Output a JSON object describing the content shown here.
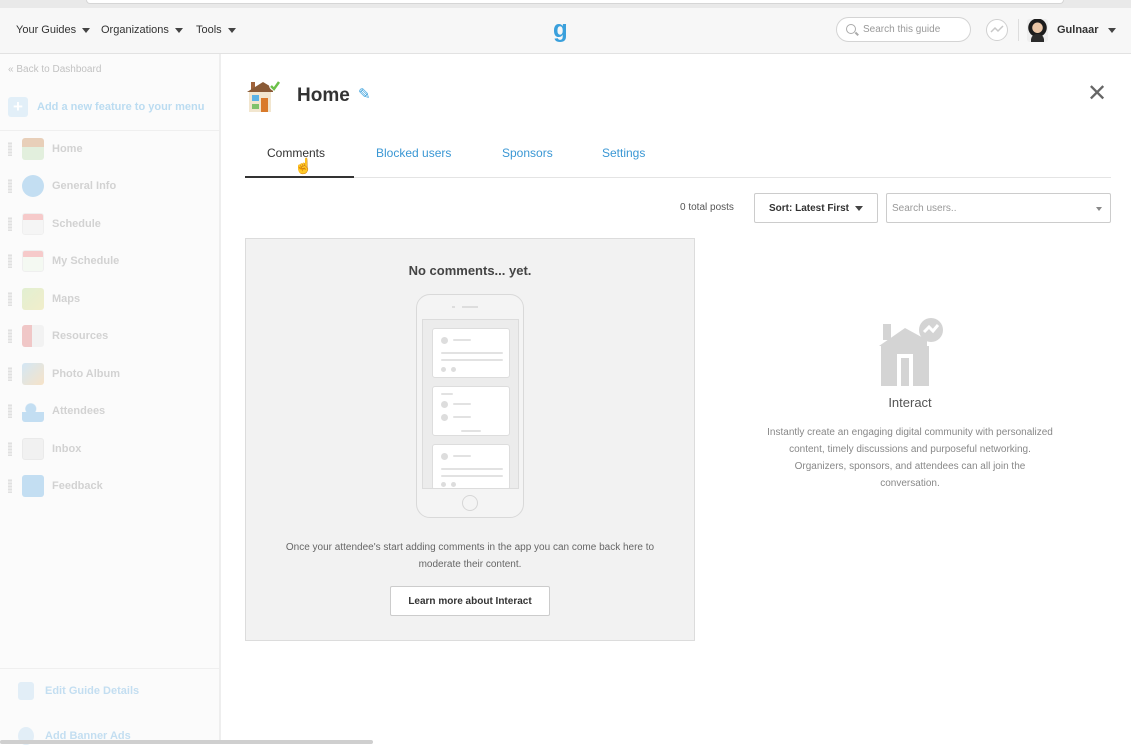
{
  "topbar": {
    "menus": [
      {
        "label": "Your Guides"
      },
      {
        "label": "Organizations"
      },
      {
        "label": "Tools"
      }
    ],
    "logo_text": "g",
    "search_placeholder": "Search this guide",
    "user_name": "Gulnaar"
  },
  "sidebar": {
    "back_link": "« Back to Dashboard",
    "add_feature_label": "Add a new feature to your menu",
    "items": [
      {
        "label": "Home",
        "icon": "house-icon"
      },
      {
        "label": "General Info",
        "icon": "info-icon"
      },
      {
        "label": "Schedule",
        "icon": "calendar-icon"
      },
      {
        "label": "My Schedule",
        "icon": "calendar-check-icon"
      },
      {
        "label": "Maps",
        "icon": "map-icon"
      },
      {
        "label": "Resources",
        "icon": "book-icon"
      },
      {
        "label": "Photo Album",
        "icon": "photo-icon"
      },
      {
        "label": "Attendees",
        "icon": "people-icon"
      },
      {
        "label": "Inbox",
        "icon": "envelope-icon"
      },
      {
        "label": "Feedback",
        "icon": "chat-icon"
      }
    ],
    "footer": [
      {
        "label": "Edit Guide Details"
      },
      {
        "label": "Add Banner Ads"
      }
    ]
  },
  "main": {
    "title": "Home",
    "tabs": [
      {
        "label": "Comments",
        "active": true
      },
      {
        "label": "Blocked users",
        "active": false
      },
      {
        "label": "Sponsors",
        "active": false
      },
      {
        "label": "Settings",
        "active": false
      }
    ],
    "total_posts": "0 total posts",
    "sort_label": "Sort: Latest First",
    "users_search_placeholder": "Search users..",
    "empty_state": {
      "title": "No comments... yet.",
      "description": "Once your attendee's start adding comments in the app you can come back here to moderate their content.",
      "button_label": "Learn more about Interact"
    },
    "interact": {
      "title": "Interact",
      "description": "Instantly create an engaging digital community with personalized content, timely discussions and purposeful networking. Organizers, sponsors, and attendees can all join the conversation."
    }
  },
  "colors": {
    "accent": "#3a97d4",
    "logo": "#3aa0dc"
  }
}
